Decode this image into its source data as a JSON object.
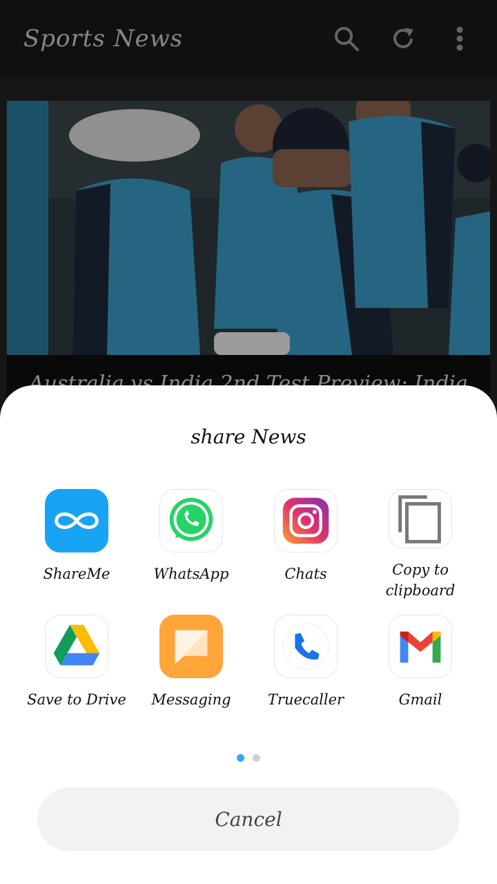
{
  "app_bar": {
    "title": "Sports News",
    "icons": [
      "search-icon",
      "refresh-icon",
      "more-vert-icon"
    ]
  },
  "news": {
    "headline": "Australia vs India 2nd Test Preview: India"
  },
  "share_sheet": {
    "title": "share News",
    "apps": [
      {
        "label": "ShareMe",
        "icon": "shareme-icon"
      },
      {
        "label": "WhatsApp",
        "icon": "whatsapp-icon"
      },
      {
        "label": "Chats",
        "icon": "instagram-icon"
      },
      {
        "label": "Copy to clipboard",
        "icon": "copy-icon"
      },
      {
        "label": "Save to Drive",
        "icon": "drive-icon"
      },
      {
        "label": "Messaging",
        "icon": "messaging-icon"
      },
      {
        "label": "Truecaller",
        "icon": "truecaller-icon"
      },
      {
        "label": "Gmail",
        "icon": "gmail-icon"
      }
    ],
    "page_indicator": {
      "pages": 2,
      "current": 1
    },
    "cancel_label": "Cancel"
  },
  "colors": {
    "app_bar": "#1a1a1a",
    "accent_dot": "#2fa8ef",
    "sheet": "#ffffff"
  }
}
